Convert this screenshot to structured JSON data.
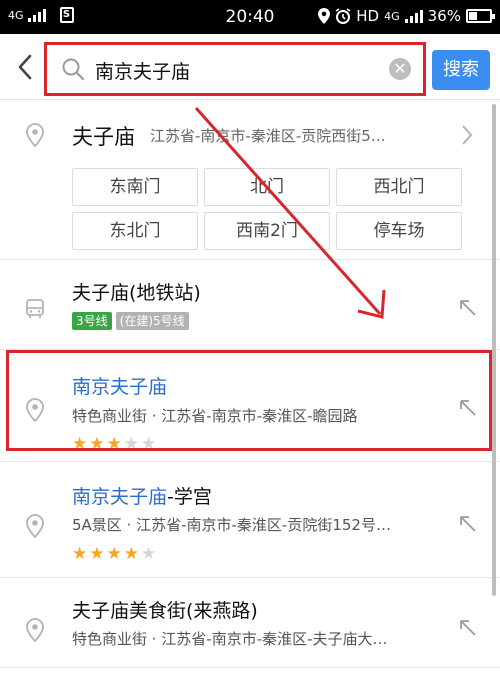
{
  "status_bar": {
    "network": "4G",
    "time": "20:40",
    "hd": "HD",
    "net2": "4G",
    "battery": "36%",
    "sim_label": "S"
  },
  "header": {
    "query": "南京夫子庙",
    "search_label": "搜索"
  },
  "first_result": {
    "title": "夫子庙",
    "address": "江苏省-南京市-秦淮区-贡院西街5…",
    "gates": [
      "东南门",
      "北门",
      "西北门",
      "东北门",
      "西南2门",
      "停车场"
    ]
  },
  "metro": {
    "title": "夫子庙(地铁站)",
    "line_badge": "3号线",
    "line_badge2": "(在建)5号线"
  },
  "results": [
    {
      "title_hl": "南京夫子庙",
      "title_rest": "",
      "subtitle": "特色商业街 · 江苏省-南京市-秦淮区-瞻园路",
      "rating": 3
    },
    {
      "title_hl": "南京夫子庙",
      "title_rest": "-学宫",
      "subtitle": "5A景区 · 江苏省-南京市-秦淮区-贡院街152号…",
      "rating": 4
    },
    {
      "title_hl": "",
      "title_rest": "夫子庙美食街(来燕路)",
      "subtitle": "特色商业街 · 江苏省-南京市-秦淮区-夫子庙大…"
    }
  ],
  "colors": {
    "accent_blue": "#3b8ef0",
    "highlight_red": "#d9262b",
    "star_on": "#f7a623"
  },
  "icons": [
    "back-icon",
    "search-icon",
    "clear-icon",
    "location-pin-icon",
    "chevron-right-icon",
    "bus-icon",
    "navigate-arrow-icon",
    "star-icon"
  ]
}
